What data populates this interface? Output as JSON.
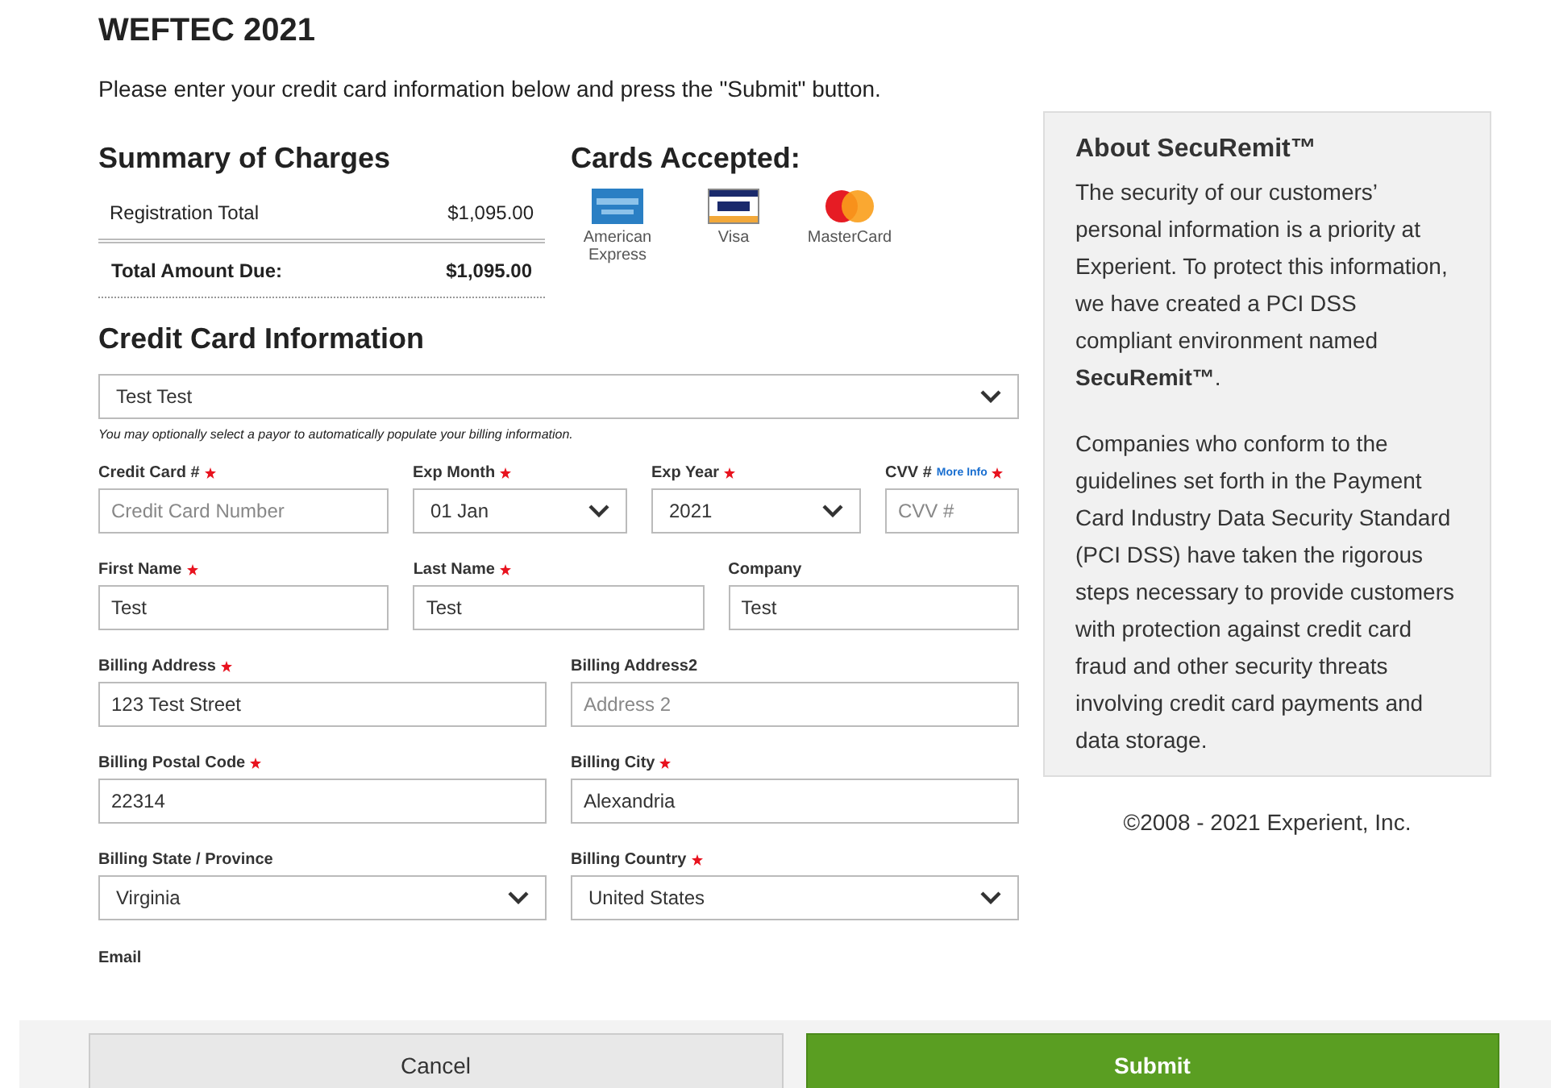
{
  "title": "WEFTEC 2021",
  "intro": "Please enter your credit card information below and press the \"Submit\" button.",
  "summary": {
    "heading": "Summary of Charges",
    "rows": [
      {
        "label": "Registration Total",
        "amount": "$1,095.00",
        "total": false
      },
      {
        "label": "Total Amount Due:",
        "amount": "$1,095.00",
        "total": true
      }
    ]
  },
  "cards": {
    "heading": "Cards Accepted:",
    "items": [
      {
        "kind": "amex",
        "caption": "American Express"
      },
      {
        "kind": "visa",
        "caption": "Visa"
      },
      {
        "kind": "mastercard",
        "caption": "MasterCard"
      }
    ]
  },
  "credit_card": {
    "heading": "Credit Card Information",
    "payor": {
      "value": "Test Test"
    },
    "hint": "You may optionally select a payor to automatically populate your billing information.",
    "rows": [
      {
        "fields": [
          {
            "label": "Credit Card #",
            "required": true,
            "kind": "input",
            "placeholder": "Credit Card Number"
          },
          {
            "label": "Exp Month",
            "required": true,
            "kind": "select",
            "value": "01 Jan"
          },
          {
            "label": "Exp Year",
            "required": true,
            "kind": "select",
            "value": "2021"
          },
          {
            "label": "CVV #",
            "link": "More Info",
            "required": true,
            "kind": "input",
            "placeholder": "CVV #"
          }
        ]
      },
      {
        "fields": [
          {
            "label": "First Name",
            "required": true,
            "kind": "input",
            "value": "Test"
          },
          {
            "label": "Last Name",
            "required": true,
            "kind": "input",
            "value": "Test"
          },
          {
            "label": "Company",
            "required": false,
            "kind": "input",
            "value": "Test"
          }
        ]
      },
      {
        "fields": [
          {
            "label": "Billing Address",
            "required": true,
            "kind": "input",
            "value": "123 Test Street"
          },
          {
            "label": "Billing Address2",
            "required": false,
            "kind": "input",
            "placeholder": "Address 2"
          }
        ]
      },
      {
        "fields": [
          {
            "label": "Billing Postal Code",
            "required": true,
            "kind": "input",
            "value": "22314"
          },
          {
            "label": "Billing City",
            "required": true,
            "kind": "input",
            "value": "Alexandria"
          }
        ]
      },
      {
        "fields": [
          {
            "label": "Billing State / Province",
            "required": false,
            "kind": "select",
            "value": "Virginia"
          },
          {
            "label": "Billing Country",
            "required": true,
            "kind": "select",
            "value": "United States"
          }
        ]
      }
    ],
    "email_label": "Email"
  },
  "about": {
    "heading": "About SecuRemit™",
    "paragraphs": [
      "The security of our customers’ personal information is a priority at Experient. To protect this information, we have created a PCI DSS compliant environment named **SecuRemit™**.",
      "Companies who conform to the guidelines set forth in the Payment Card Industry Data Security Standard (PCI DSS) have taken the rigorous steps necessary to provide customers with protection against credit card fraud and other security threats involving credit card payments and data storage."
    ]
  },
  "copyright": "©2008 - 2021 Experient, Inc.",
  "buttons": [
    {
      "label": "Cancel",
      "kind": "secondary"
    },
    {
      "label": "Submit",
      "kind": "primary"
    }
  ]
}
